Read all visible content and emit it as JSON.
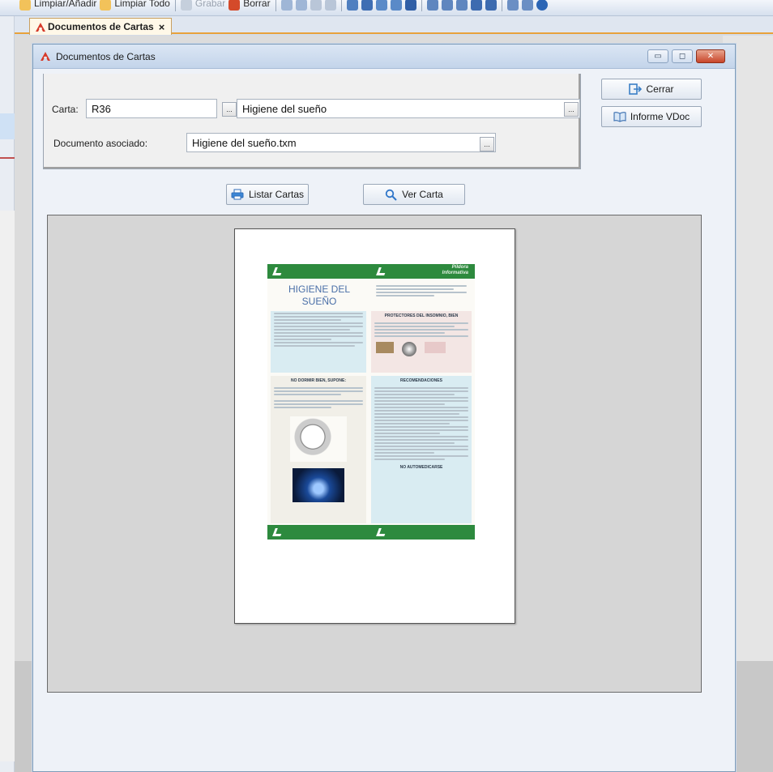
{
  "toolbar": {
    "items": [
      {
        "label": "Limpiar/Añadir",
        "icon": "eraser-icon"
      },
      {
        "label": "Limpiar Todo",
        "icon": "eraser-all-icon"
      },
      {
        "label": "Grabar",
        "icon": "save-icon"
      },
      {
        "label": "Borrar",
        "icon": "delete-icon"
      }
    ]
  },
  "tab": {
    "label": "Documentos de Cartas",
    "close": "×"
  },
  "window": {
    "title": "Documentos de Cartas",
    "min": "▭",
    "restore": "◻",
    "close": "✕"
  },
  "form": {
    "carta_label": "Carta:",
    "carta_code": "R36",
    "carta_name": "Higiene del sueño",
    "doc_label": "Documento asociado:",
    "doc_value": "Higiene del sueño.txm",
    "lookup": "..."
  },
  "buttons": {
    "cerrar": "Cerrar",
    "informe": "Informe VDoc",
    "listar": "Listar Cartas",
    "ver": "Ver Carta"
  },
  "poster": {
    "header_right": "Píldora Informativa",
    "title": "HIGIENE DEL SUEÑO",
    "section_left": "NO DORMIR BIEN, SUPONE:",
    "section_right_top": "PROTECTORES DEL INSOMNIO, BIEN",
    "section_right": "RECOMENDACIONES",
    "footer": "NO AUTOMEDICARSE"
  },
  "colors": {
    "accent": "#e8a23a",
    "poster_green": "#2d8a3e",
    "poster_blue_panel": "#d9ecf2",
    "poster_title": "#4a6fa8"
  }
}
